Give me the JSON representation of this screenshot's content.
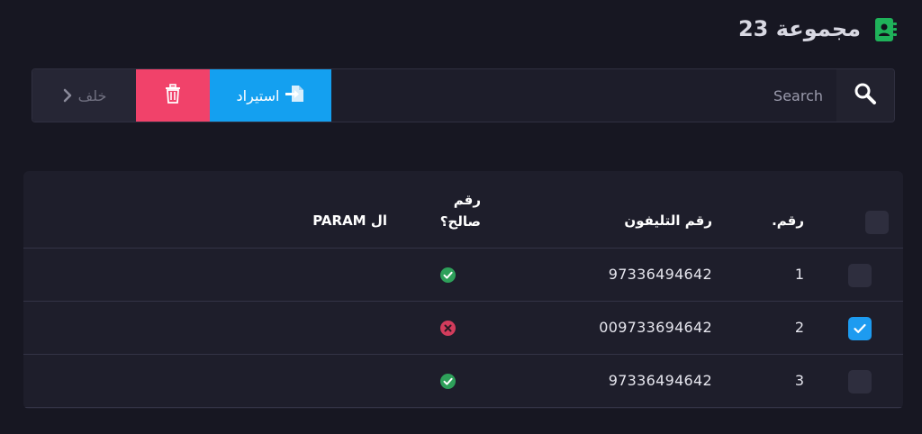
{
  "header": {
    "title": "مجموعة 23",
    "icon": "contact-book-icon",
    "icon_color": "#1fb25a"
  },
  "toolbar": {
    "back_label": "خلف",
    "delete_icon": "trash-icon",
    "import_label": "استيراد",
    "import_icon": "file-import-icon",
    "search_placeholder": "Search",
    "search_value": "",
    "colors": {
      "delete": "#f1426a",
      "import": "#14a0f0",
      "back": "#262635"
    }
  },
  "table": {
    "columns": {
      "number": "رقم.",
      "phone": "رقم التليفون",
      "valid": "رقم صالح؟",
      "param": "ال PARAM"
    },
    "rows": [
      {
        "number": "1",
        "phone": "97336494642",
        "valid": true,
        "checked": false
      },
      {
        "number": "2",
        "phone": "009733694642",
        "valid": false,
        "checked": true
      },
      {
        "number": "3",
        "phone": "97336494642",
        "valid": true,
        "checked": false
      }
    ],
    "status_colors": {
      "valid": "#2ea05a",
      "invalid": "#d23c5c"
    }
  }
}
